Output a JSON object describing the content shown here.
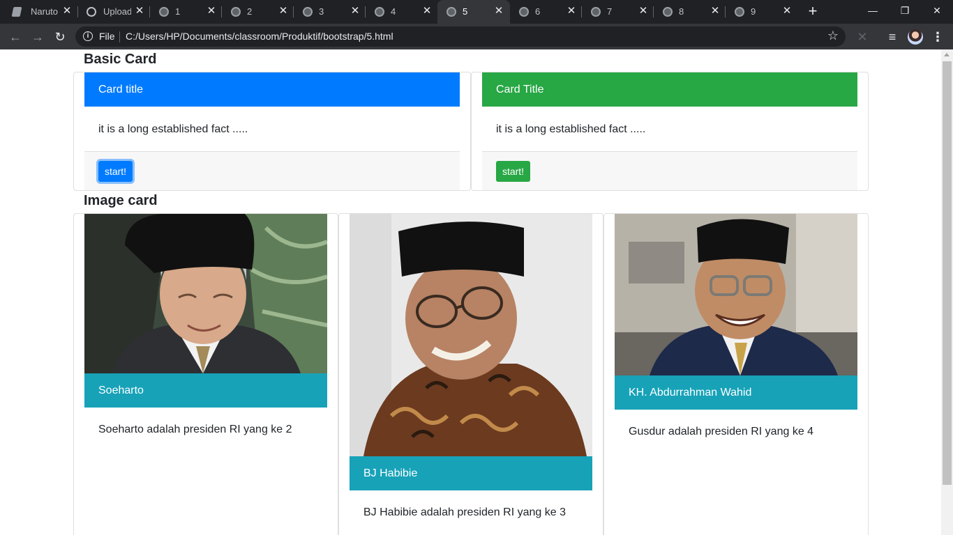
{
  "browser": {
    "tabs": [
      {
        "title": "Naruto",
        "icon": "document-icon",
        "active": false
      },
      {
        "title": "Upload",
        "icon": "github-icon",
        "active": false
      },
      {
        "title": "1",
        "icon": "globe-icon",
        "active": false
      },
      {
        "title": "2",
        "icon": "globe-icon",
        "active": false
      },
      {
        "title": "3",
        "icon": "globe-icon",
        "active": false
      },
      {
        "title": "4",
        "icon": "globe-icon",
        "active": false
      },
      {
        "title": "5",
        "icon": "globe-icon",
        "active": true
      },
      {
        "title": "6",
        "icon": "globe-icon",
        "active": false
      },
      {
        "title": "7",
        "icon": "globe-icon",
        "active": false
      },
      {
        "title": "8",
        "icon": "globe-icon",
        "active": false
      },
      {
        "title": "9",
        "icon": "globe-icon",
        "active": false
      }
    ],
    "close_glyph": "✕",
    "new_tab_glyph": "+",
    "window": {
      "minimize": "—",
      "restore": "❐",
      "close": "✕"
    },
    "nav": {
      "back": "←",
      "forward": "→",
      "reload": "↻"
    },
    "address": {
      "info_glyph": "i",
      "scheme_label": "File",
      "url": "C:/Users/HP/Documents/classroom/Produktif/bootstrap/5.html",
      "star_glyph": "☆"
    },
    "extensions": [
      "✕",
      "≡"
    ],
    "menu_glyph": "⋮"
  },
  "page": {
    "basic_section_title": "Basic Card",
    "basic_cards": [
      {
        "header": "Card title",
        "text": "it is a long established fact .....",
        "button": "start!",
        "color": "#007bff"
      },
      {
        "header": "Card Title",
        "text": "it is a long established fact .....",
        "button": "start!",
        "color": "#28a745"
      }
    ],
    "image_section_title": "Image card",
    "image_cards": [
      {
        "name": "Soeharto",
        "text": "Soeharto adalah presiden RI yang ke 2",
        "header_color": "#17a2b8"
      },
      {
        "name": "BJ Habibie",
        "text": "BJ Habibie adalah presiden RI yang ke 3",
        "header_color": "#17a2b8"
      },
      {
        "name": "KH. Abdurrahman Wahid",
        "text": "Gusdur adalah presiden RI yang ke 4",
        "header_color": "#17a2b8"
      }
    ]
  }
}
